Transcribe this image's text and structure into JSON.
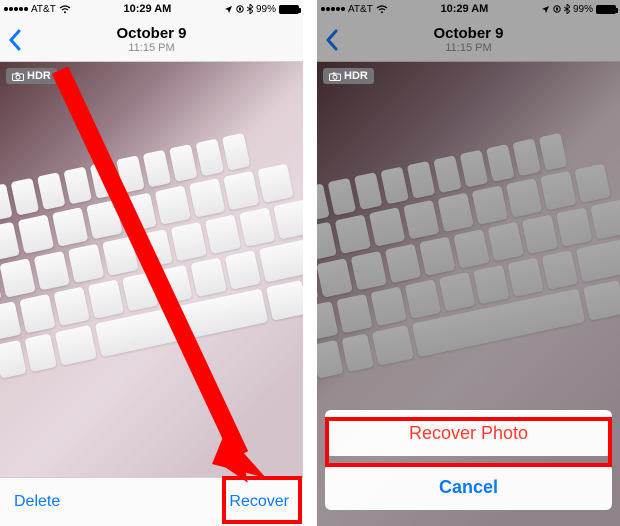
{
  "statusbar": {
    "carrier": "AT&T",
    "time": "10:29 AM",
    "battery_pct": "99%"
  },
  "nav": {
    "title": "October 9",
    "subtitle": "11:15 PM"
  },
  "badge": {
    "hdr": "HDR"
  },
  "toolbar": {
    "delete": "Delete",
    "recover": "Recover"
  },
  "actionsheet": {
    "recover_photo": "Recover Photo",
    "cancel": "Cancel"
  },
  "colors": {
    "ios_blue": "#0b79fe",
    "ios_red": "#ff3b30",
    "highlight": "#ff0000"
  }
}
